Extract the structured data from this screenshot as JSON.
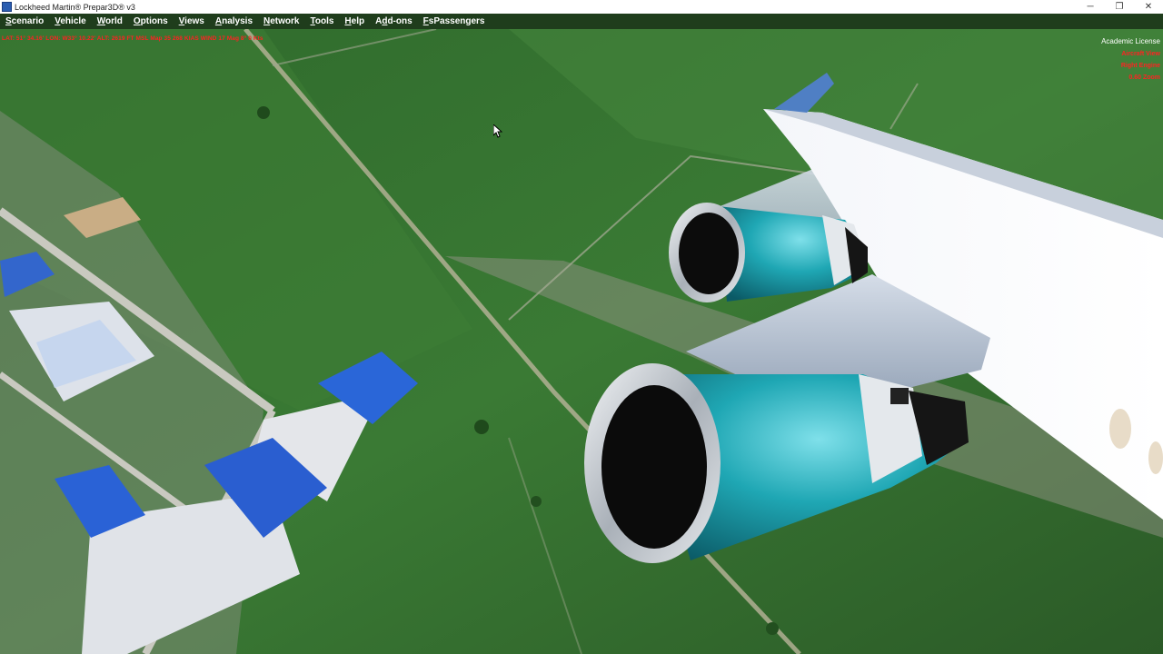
{
  "window": {
    "title": "Lockheed Martin® Prepar3D® v3",
    "controls": {
      "minimize": "─",
      "restore": "❐",
      "close": "✕"
    }
  },
  "menu": {
    "items": [
      {
        "pre": "",
        "ul": "S",
        "post": "cenario"
      },
      {
        "pre": "",
        "ul": "V",
        "post": "ehicle"
      },
      {
        "pre": "",
        "ul": "W",
        "post": "orld"
      },
      {
        "pre": "",
        "ul": "O",
        "post": "ptions"
      },
      {
        "pre": "",
        "ul": "V",
        "post": "iews"
      },
      {
        "pre": "",
        "ul": "A",
        "post": "nalysis"
      },
      {
        "pre": "",
        "ul": "N",
        "post": "etwork"
      },
      {
        "pre": "",
        "ul": "T",
        "post": "ools"
      },
      {
        "pre": "",
        "ul": "H",
        "post": "elp"
      },
      {
        "pre": "A",
        "ul": "d",
        "post": "d-ons"
      },
      {
        "pre": "",
        "ul": "F",
        "post": "sPassengers"
      }
    ]
  },
  "hud": {
    "status_line": "LAT: 51° 34.16'  LON: W33° 10.22'  ALT: 2619 FT  MSL  Map 35  268 KIAS  WIND 17 Mag 8° 0 Kts",
    "license": "Academic License",
    "right_lines": [
      "Aircraft View",
      "Right Engine",
      "0.60 Zoom"
    ]
  },
  "colors": {
    "hud_red": "#ff2222",
    "menu_bg": "#1f3d1c",
    "nacelle_teal": "#1fa7b4",
    "grass": "#2e5e2a"
  }
}
